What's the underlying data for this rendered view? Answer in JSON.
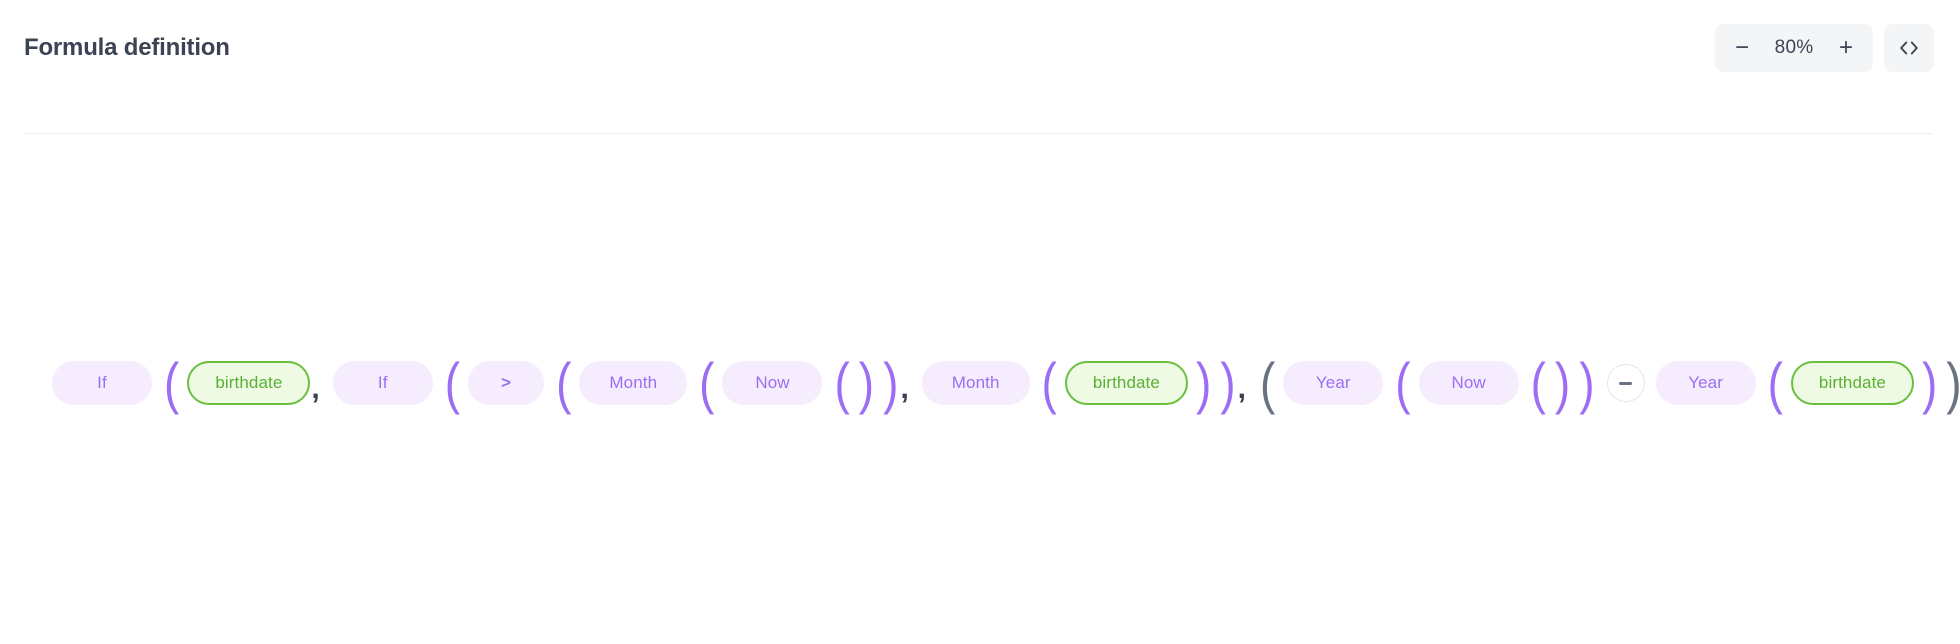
{
  "header": {
    "title": "Formula definition",
    "zoom": {
      "decrease_label": "−",
      "decrease_name": "minus-icon",
      "value": "80%",
      "increase_label": "+",
      "increase_name": "plus-icon"
    },
    "code_button": {
      "label": "<>",
      "name": "code-brackets-icon"
    }
  },
  "formula": {
    "expression": "If(birthdate, If(>(Month(Now()), Month(birthdate)), (Year(Now()) - Year(birthdate)),",
    "tokens": [
      {
        "kind": "function",
        "label": "If"
      },
      {
        "kind": "paren-open",
        "label": "(",
        "color": "purple"
      },
      {
        "kind": "field",
        "label": "birthdate"
      },
      {
        "kind": "comma",
        "label": ","
      },
      {
        "kind": "function",
        "label": "If"
      },
      {
        "kind": "paren-open",
        "label": "(",
        "color": "purple"
      },
      {
        "kind": "operator",
        "label": ">"
      },
      {
        "kind": "paren-open",
        "label": "(",
        "color": "purple"
      },
      {
        "kind": "function",
        "label": "Month"
      },
      {
        "kind": "paren-open",
        "label": "(",
        "color": "purple"
      },
      {
        "kind": "function",
        "label": "Now"
      },
      {
        "kind": "paren-open",
        "label": "(",
        "color": "purple"
      },
      {
        "kind": "paren-close",
        "label": ")",
        "color": "purple"
      },
      {
        "kind": "paren-close",
        "label": ")",
        "color": "purple"
      },
      {
        "kind": "comma",
        "label": ","
      },
      {
        "kind": "function",
        "label": "Month"
      },
      {
        "kind": "paren-open",
        "label": "(",
        "color": "purple"
      },
      {
        "kind": "field",
        "label": "birthdate"
      },
      {
        "kind": "paren-close",
        "label": ")",
        "color": "purple"
      },
      {
        "kind": "paren-close",
        "label": ")",
        "color": "purple"
      },
      {
        "kind": "comma",
        "label": ","
      },
      {
        "kind": "paren-open",
        "label": "(",
        "color": "gray"
      },
      {
        "kind": "function",
        "label": "Year"
      },
      {
        "kind": "paren-open",
        "label": "(",
        "color": "purple"
      },
      {
        "kind": "function",
        "label": "Now"
      },
      {
        "kind": "paren-open",
        "label": "(",
        "color": "purple"
      },
      {
        "kind": "paren-close",
        "label": ")",
        "color": "purple"
      },
      {
        "kind": "paren-close",
        "label": ")",
        "color": "purple"
      },
      {
        "kind": "minus-operator",
        "label": "−"
      },
      {
        "kind": "function",
        "label": "Year"
      },
      {
        "kind": "paren-open",
        "label": "(",
        "color": "purple"
      },
      {
        "kind": "field",
        "label": "birthdate"
      },
      {
        "kind": "paren-close",
        "label": ")",
        "color": "purple"
      },
      {
        "kind": "paren-close",
        "label": ")",
        "color": "gray"
      },
      {
        "kind": "comma",
        "label": ","
      },
      {
        "kind": "clipped-chip",
        "label": ""
      }
    ]
  },
  "colors": {
    "chip_function_bg": "#f5ecfd",
    "chip_function_text": "#9b6ef3",
    "chip_field_bg": "#eefae4",
    "chip_field_border": "#6abf3f",
    "chip_field_text": "#5bb034",
    "paren_purple": "#9b6ef3",
    "paren_gray": "#6b7280",
    "title_text": "#3b4354",
    "divider": "#eceef1",
    "control_bg": "#f4f5f7"
  }
}
